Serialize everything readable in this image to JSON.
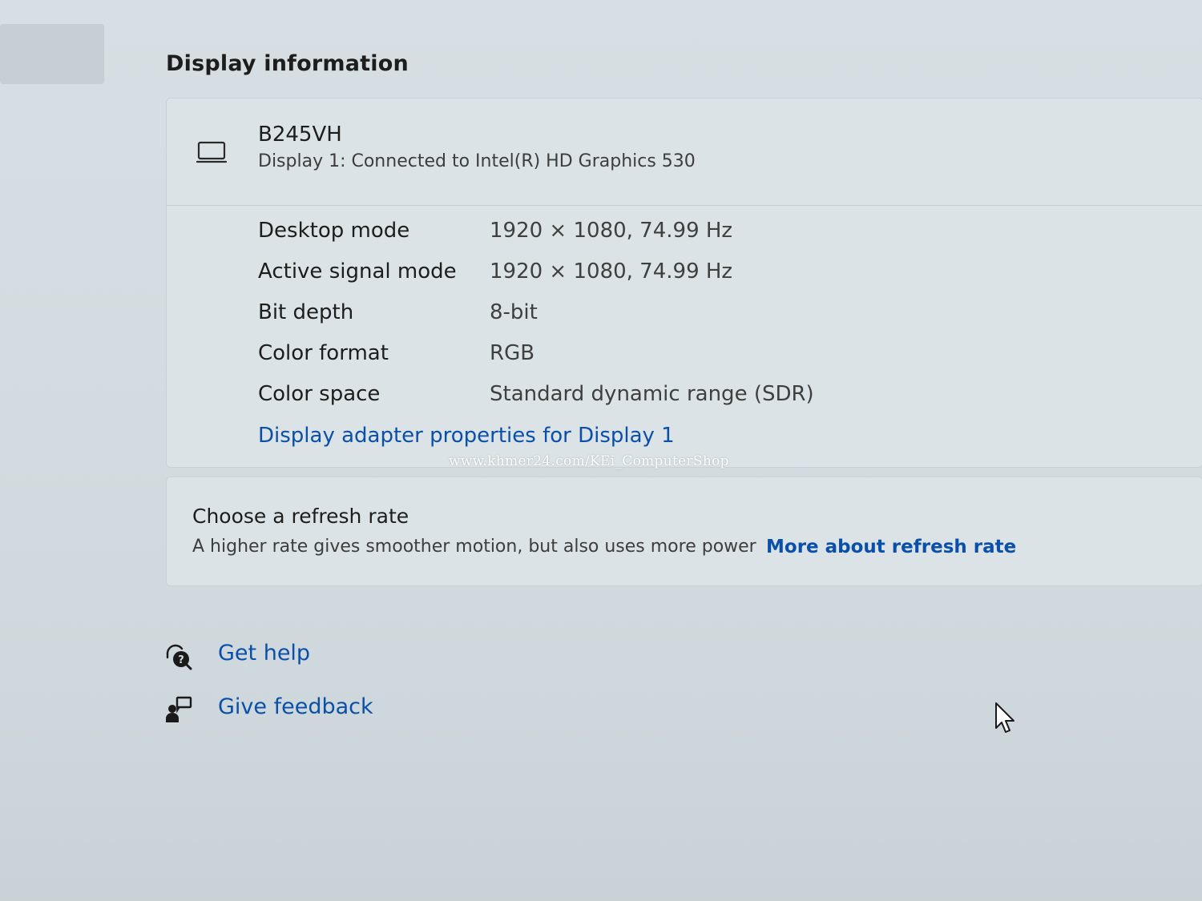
{
  "section": {
    "title": "Display information"
  },
  "monitor": {
    "icon": "monitor-icon",
    "name": "B245VH",
    "connection": "Display 1: Connected to Intel(R) HD Graphics 530"
  },
  "info_rows": [
    {
      "label": "Desktop mode",
      "value": "1920 × 1080, 74.99 Hz"
    },
    {
      "label": "Active signal mode",
      "value": "1920 × 1080, 74.99 Hz"
    },
    {
      "label": "Bit depth",
      "value": "8-bit"
    },
    {
      "label": "Color format",
      "value": "RGB"
    },
    {
      "label": "Color space",
      "value": "Standard dynamic range (SDR)"
    }
  ],
  "adapter_link": "Display adapter properties for Display 1",
  "watermark": "www.khmer24.com/KEi_ComputerShop",
  "refresh": {
    "title": "Choose a refresh rate",
    "description": "A higher rate gives smoother motion, but also uses more power",
    "link": "More about refresh rate"
  },
  "help": {
    "get_help": "Get help",
    "give_feedback": "Give feedback"
  },
  "colors": {
    "accent_link": "#0a4fa8",
    "background": "#d3dce0",
    "card": "#dbe3e6"
  }
}
